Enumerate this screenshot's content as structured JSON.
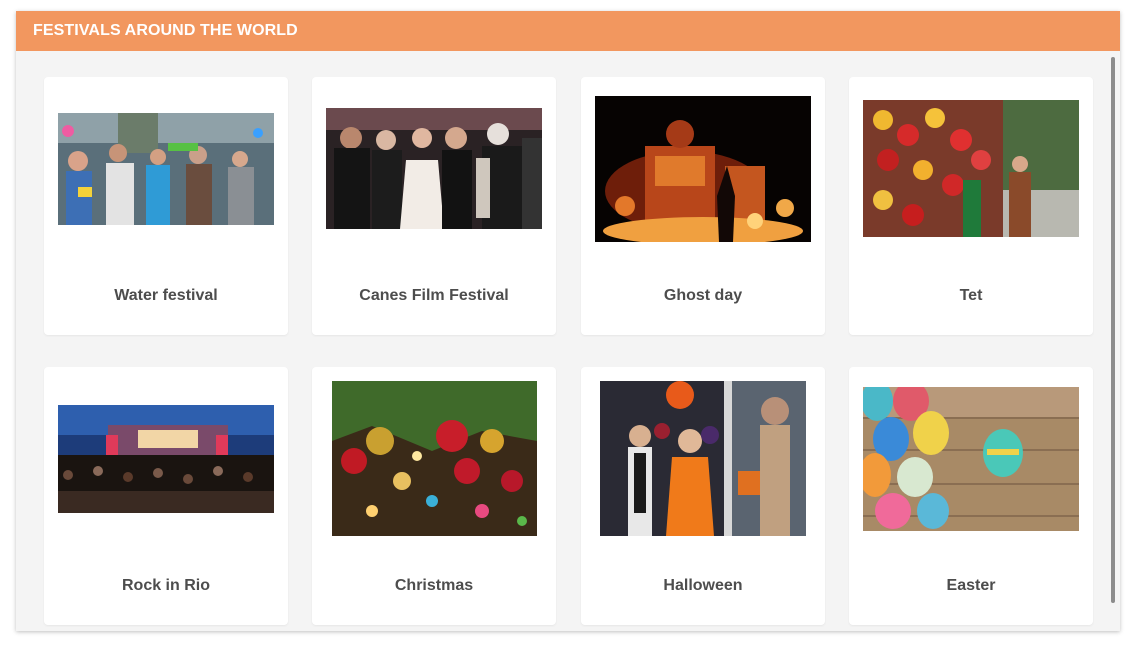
{
  "header": {
    "title": "FESTIVALS AROUND THE WORLD",
    "color": "#f2975f"
  },
  "festivals": [
    {
      "label": "Water festival",
      "icon": "water-festival-photo"
    },
    {
      "label": "Canes Film Festival",
      "icon": "film-festival-photo"
    },
    {
      "label": "Ghost day",
      "icon": "ghost-day-photo"
    },
    {
      "label": "Tet",
      "icon": "tet-photo"
    },
    {
      "label": "Rock in Rio",
      "icon": "rock-in-rio-photo"
    },
    {
      "label": "Christmas",
      "icon": "christmas-photo"
    },
    {
      "label": "Halloween",
      "icon": "halloween-photo"
    },
    {
      "label": "Easter",
      "icon": "easter-photo"
    }
  ]
}
